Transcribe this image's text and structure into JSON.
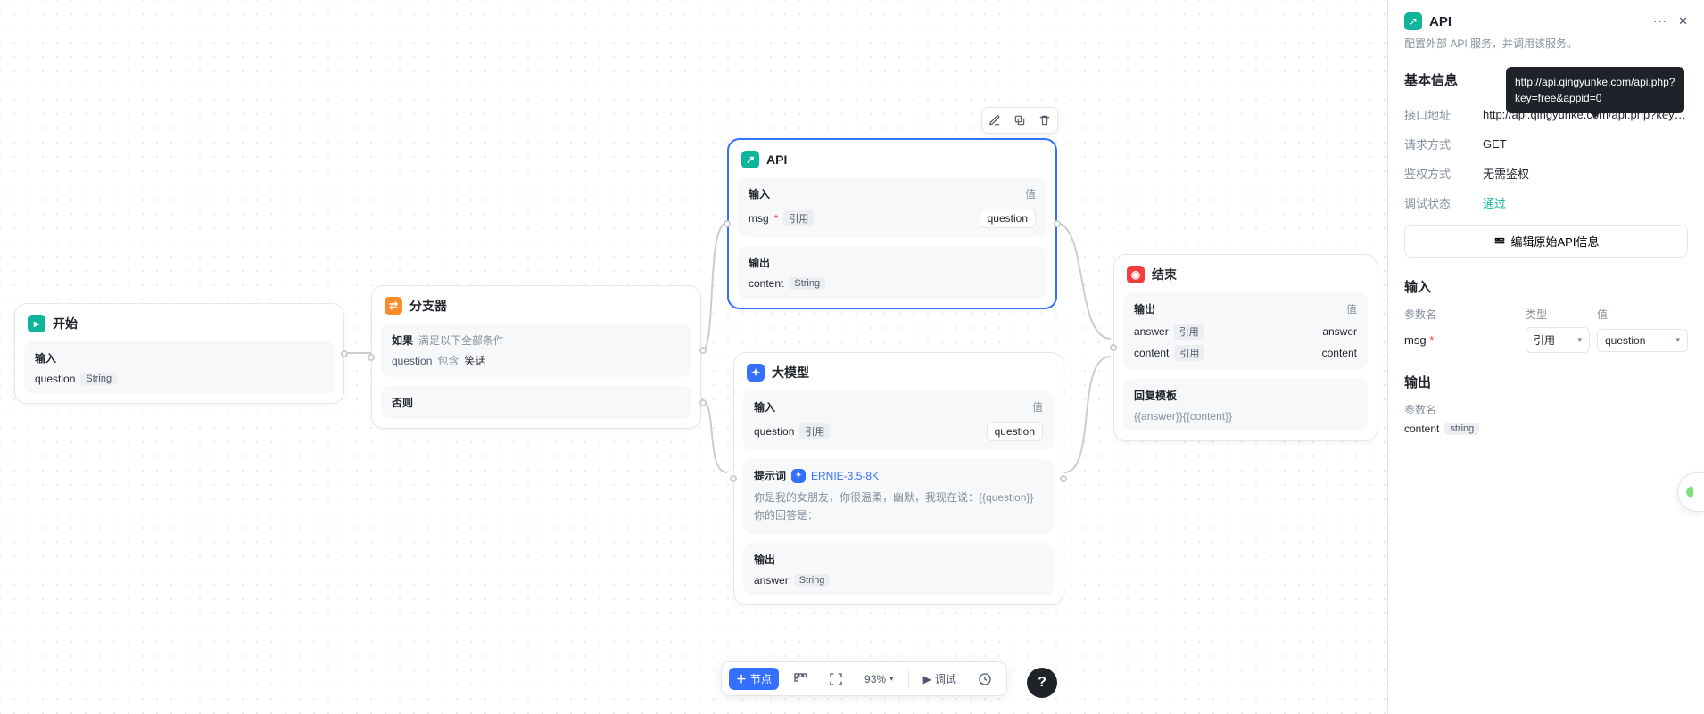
{
  "canvas": {
    "nodes": {
      "start": {
        "title": "开始",
        "input_label": "输入",
        "param": "question",
        "param_type": "String"
      },
      "branch": {
        "title": "分支器",
        "if_label": "如果",
        "if_desc": "满足以下全部条件",
        "cond_field": "question",
        "cond_op": "包含",
        "cond_value": "笑话",
        "else_label": "否则"
      },
      "api": {
        "title": "API",
        "input_label": "输入",
        "value_label": "值",
        "param": "msg",
        "param_tag": "引用",
        "param_value": "question",
        "output_label": "输出",
        "out_param": "content",
        "out_type": "String"
      },
      "llm": {
        "title": "大模型",
        "input_label": "输入",
        "value_label": "值",
        "param": "question",
        "param_tag": "引用",
        "param_value": "question",
        "prompt_label": "提示词",
        "model": "ERNIE-3.5-8K",
        "prompt_text": "你是我的女朋友，你很温柔，幽默，我现在说：{{question}}\n你的回答是：",
        "output_label": "输出",
        "out_param": "answer",
        "out_type": "String"
      },
      "end": {
        "title": "结束",
        "output_label": "输出",
        "value_label": "值",
        "rows": [
          {
            "name": "answer",
            "tag": "引用",
            "value": "answer"
          },
          {
            "name": "content",
            "tag": "引用",
            "value": "content"
          }
        ],
        "tpl_label": "回复模板",
        "tpl": "{{answer}}{{content}}"
      }
    },
    "toolbar": {
      "node_label": "节点",
      "zoom": "93%",
      "debug": "调试"
    }
  },
  "side": {
    "title": "API",
    "desc": "配置外部 API 服务，并调用该服务。",
    "sections": {
      "basic": "基本信息",
      "input": "输入",
      "output": "输出"
    },
    "basic": {
      "url_label": "接口地址",
      "url": "http://api.qingyunke.com/api.php?key=free...",
      "url_full": "http://api.qingyunke.com/api.php?key=free&appid=0",
      "method_label": "请求方式",
      "method": "GET",
      "auth_label": "鉴权方式",
      "auth": "无需鉴权",
      "debug_label": "调试状态",
      "debug_status": "通过",
      "edit_btn": "编辑原始API信息"
    },
    "input": {
      "col_param": "参数名",
      "col_type": "类型",
      "col_value": "值",
      "param": "msg",
      "param_type": "引用",
      "param_value": "question"
    },
    "output": {
      "col_param": "参数名",
      "param": "content",
      "param_type": "string"
    }
  }
}
